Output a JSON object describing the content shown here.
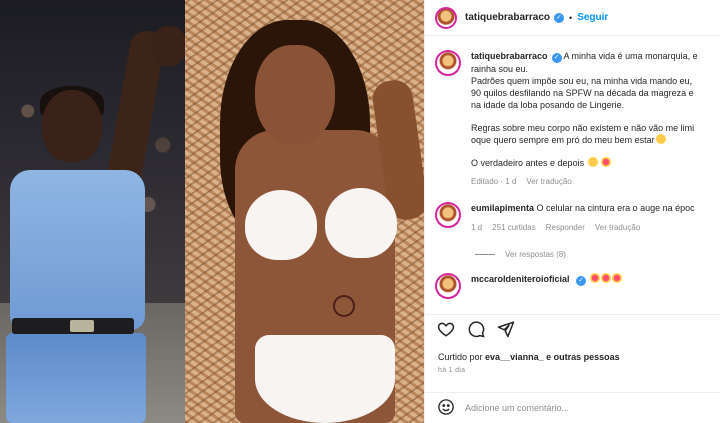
{
  "header": {
    "username": "tatiquebrabarraco",
    "follow_label": "Seguir",
    "separator": "•"
  },
  "caption": {
    "username": "tatiquebrabarraco",
    "line1": "A minha vida é uma monarquia, e",
    "line2": "rainha sou eu.",
    "line3": "Padrões quem impõe sou eu, na minha vida mando eu,",
    "line4": "90 quilos desfilando na SPFW na década da magreza e",
    "line5": "na idade da loba posando de Lingerie.",
    "line6": "Regras sobre meu corpo não existem e não vão me limi",
    "line7": "oque quero sempre em pró do meu bem estar",
    "line8": "O verdadeiro antes e depois",
    "edited": "Editado · 1 d",
    "translate": "Ver tradução"
  },
  "comment1": {
    "username": "eumilapimenta",
    "text": "O celular na cintura era o auge na époc",
    "age": "1 d",
    "likes": "251 curtidas",
    "reply": "Responder",
    "translate": "Ver tradução",
    "view_replies": "Ver respostas (8)"
  },
  "comment2": {
    "username": "mccaroldeniteroioficial"
  },
  "actions": {
    "like_icon": "heart-icon",
    "comment_icon": "comment-icon",
    "share_icon": "share-icon"
  },
  "likes_summary": {
    "prefix": "Curtido por",
    "user": "eva__vianna_",
    "suffix": "e outras pessoas"
  },
  "timestamp": "há 1 dia",
  "add_comment": {
    "placeholder": "Adicione um comentário..."
  },
  "colors": {
    "accent": "#0095f6",
    "verified": "#3897f0",
    "muted": "#8e8e8e"
  }
}
